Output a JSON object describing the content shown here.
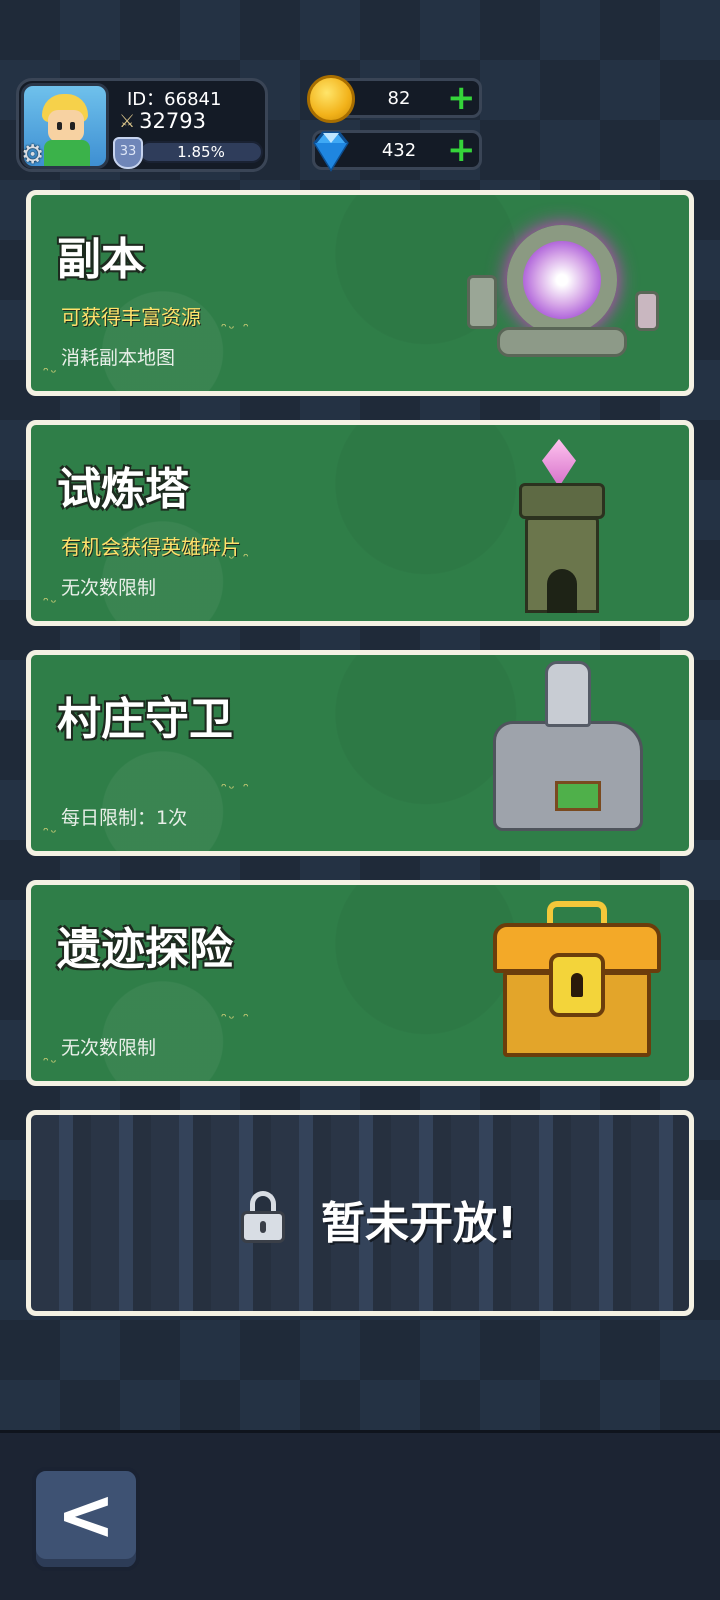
{
  "header": {
    "player_id": "ID：66841",
    "power": "32793",
    "level": "33",
    "exp_percent": "1.85%",
    "gold": "82",
    "gems": "432",
    "plus_symbol": "+"
  },
  "modes": [
    {
      "title": "副本",
      "desc": "可获得丰富资源",
      "sub": "消耗副本地图",
      "art": "portal"
    },
    {
      "title": "试炼塔",
      "desc": "有机会获得英雄碎片",
      "sub": "无次数限制",
      "art": "tower"
    },
    {
      "title": "村庄守卫",
      "desc": "",
      "sub": "每日限制：1次",
      "art": "statue"
    },
    {
      "title": "遗迹探险",
      "desc": "",
      "sub": "无次数限制",
      "art": "chest"
    }
  ],
  "locked": {
    "text": "暂未开放!"
  },
  "footer": {
    "back_symbol": "<"
  },
  "colors": {
    "card_green": "#2f7e48",
    "desc_yellow": "#ffe16b",
    "plus_green": "#35d43a"
  },
  "icons": [
    "settings-gear-icon",
    "sword-icon",
    "level-shield-icon",
    "gold-coin-icon",
    "diamond-gem-icon",
    "plus-icon",
    "lock-icon",
    "back-arrow-icon"
  ]
}
